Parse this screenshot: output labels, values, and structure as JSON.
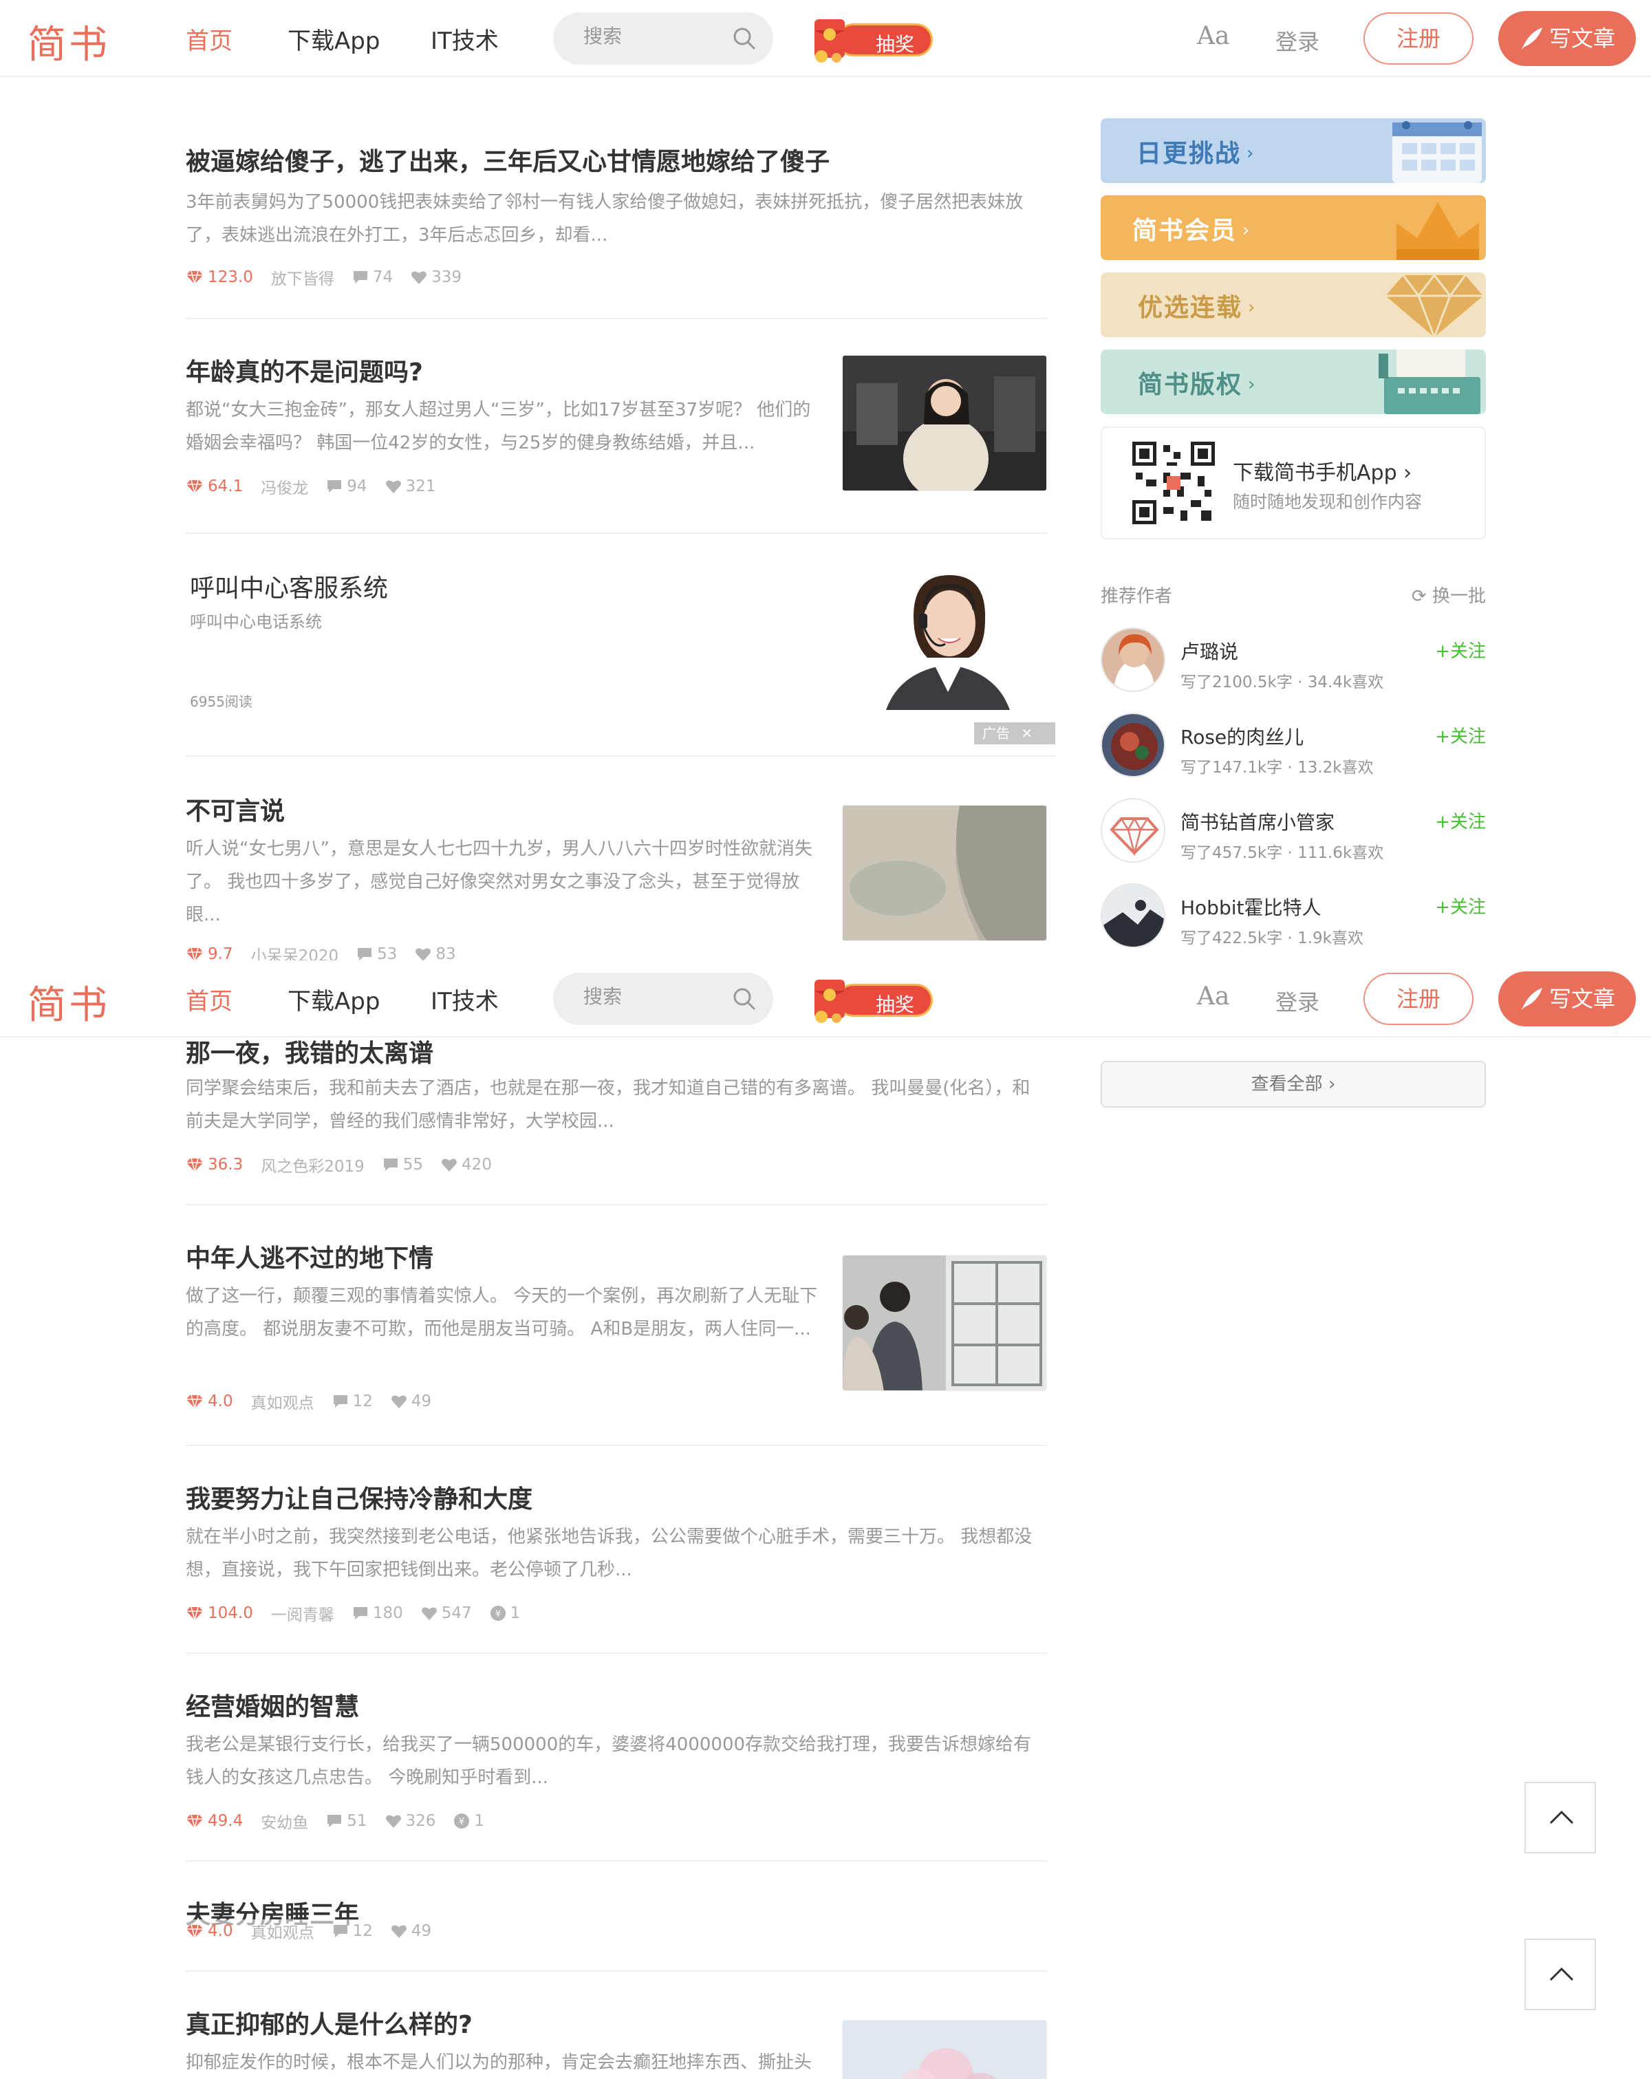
{
  "nav": {
    "logo": "简书",
    "links": [
      "首页",
      "下载App",
      "IT技术"
    ],
    "search_placeholder": "搜索",
    "lottery": "抽奖",
    "font_toggle": "Aa",
    "login": "登录",
    "register": "注册",
    "write": "写文章"
  },
  "articles": [
    {
      "title": "被逼嫁给傻子，逃了出来，三年后又心甘情愿地嫁给了傻子",
      "abstract": "3年前表舅妈为了50000钱把表妹卖给了邻村一有钱人家给傻子做媳妇，表妹拼死抵抗，傻子居然把表妹放了，表妹逃出流浪在外打工，3年后忐忑回乡，却看...",
      "diamond": "123.0",
      "author": "放下皆得",
      "comments": "74",
      "likes": "339"
    },
    {
      "title": "年龄真的不是问题吗?",
      "abstract": "都说“女大三抱金砖”，那女人超过男人“三岁”，比如17岁甚至37岁呢？ 他们的婚姻会幸福吗？ 韩国一位42岁的女性，与25岁的健身教练结婚，并且...",
      "diamond": "64.1",
      "author": "冯俊龙",
      "comments": "94",
      "likes": "321"
    },
    {
      "title": "不可言说",
      "abstract": "听人说“女七男八”，意思是女人七七四十九岁，男人八八六十四岁时性欲就消失了。 我也四十多岁了，感觉自己好像突然对男女之事没了念头，甚至于觉得放眼...",
      "diamond": "9.7",
      "author": "小呆呆2020",
      "comments": "53",
      "likes": "83"
    },
    {
      "title": "那一夜，我错的太离谱",
      "abstract": "同学聚会结束后，我和前夫去了酒店，也就是在那一夜，我才知道自己错的有多离谱。 我叫曼曼(化名），和前夫是大学同学，曾经的我们感情非常好，大学校园...",
      "diamond": "36.3",
      "author": "风之色彩2019",
      "comments": "55",
      "likes": "420"
    },
    {
      "title": "中年人逃不过的地下情",
      "abstract": "做了这一行，颠覆三观的事情着实惊人。 今天的一个案例，再次刷新了人无耻下的高度。 都说朋友妻不可欺，而他是朋友当可骑。 A和B是朋友，两人住同一...",
      "diamond": "4.0",
      "author": "真如观点",
      "comments": "12",
      "likes": "49"
    },
    {
      "title": "我要努力让自己保持冷静和大度",
      "abstract": "就在半小时之前，我突然接到老公电话，他紧张地告诉我，公公需要做个心脏手术，需要三十万。 我想都没想，直接说，我下午回家把钱倒出来。老公停顿了几秒...",
      "diamond": "104.0",
      "author": "一阅青馨",
      "comments": "180",
      "likes": "547",
      "rewards": "1"
    },
    {
      "title": "经营婚姻的智慧",
      "abstract": "我老公是某银行支行长，给我买了一辆500000的车，婆婆将4000000存款交给我打理，我要告诉想嫁给有钱人的女孩这几点忠告。 今晚刷知乎时看到...",
      "diamond": "49.4",
      "author": "安幼鱼",
      "comments": "51",
      "likes": "326",
      "rewards": "1"
    },
    {
      "title": "夫妻分房睡三年",
      "diamond": "4.0",
      "author": "真如观点",
      "comments": "12",
      "likes": "49"
    },
    {
      "title": "真正抑郁的人是什么样的?",
      "abstract": "抑郁症发作的时候，根本不是人们以为的那种，肯定会去癫狂地摔东西、撕扯头"
    }
  ],
  "ad": {
    "title": "呼叫中心客服系统",
    "subtitle": "呼叫中心电话系统",
    "reads": "6955阅读",
    "tag": "广告"
  },
  "boards": [
    {
      "label": "日更挑战",
      "color": "#bed6ee",
      "text_color": "#3f7ab6"
    },
    {
      "label": "简书会员",
      "color": "#f5b55a",
      "text_color": "#ffffff"
    },
    {
      "label": "优选连载",
      "color": "#f2e2c2",
      "text_color": "#c99a48"
    },
    {
      "label": "简书版权",
      "color": "#c8e6dd",
      "text_color": "#4f8f85"
    }
  ],
  "app_download": {
    "title": "下载简书手机App",
    "subtitle": "随时随地发现和创作内容"
  },
  "recommend": {
    "title": "推荐作者",
    "refresh": "换一批",
    "follow": "+关注",
    "authors": [
      {
        "name": "卢璐说",
        "info": "写了2100.5k字 · 34.4k喜欢"
      },
      {
        "name": "Rose的肉丝儿",
        "info": "写了147.1k字 · 13.2k喜欢"
      },
      {
        "name": "简书钻首席小管家",
        "info": "写了457.5k字 · 111.6k喜欢"
      },
      {
        "name": "Hobbit霍比特人",
        "info": "写了422.5k字 · 1.9k喜欢"
      }
    ],
    "see_all": "查看全部"
  },
  "colors": {
    "brand": "#ea6f5a",
    "follow": "#42c02e",
    "meta": "#b4b4b4"
  }
}
